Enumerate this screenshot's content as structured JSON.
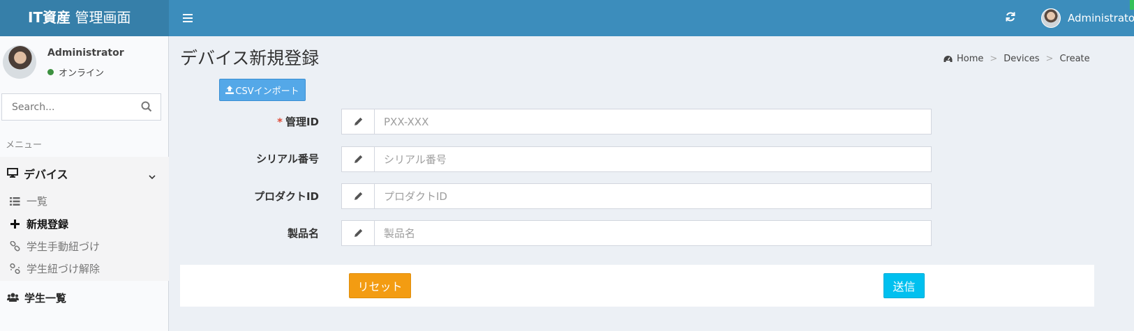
{
  "header": {
    "logo_bold": "IT資産",
    "logo_rest": " 管理画面",
    "user_name": "Administrator",
    "icons": {
      "menu": "hamburger-icon",
      "refresh": "refresh-icon"
    }
  },
  "sidebar": {
    "user": {
      "name": "Administrator",
      "status": "オンライン",
      "status_color": "#3d9140"
    },
    "search": {
      "placeholder": "Search...",
      "value": ""
    },
    "menu_header": "メニュー",
    "devices": {
      "label": "デバイス",
      "items": [
        {
          "label": "一覧",
          "icon": "list-icon",
          "active": false
        },
        {
          "label": "新規登録",
          "icon": "plus-icon",
          "active": true
        },
        {
          "label": "学生手動紐づけ",
          "icon": "link-icon",
          "active": false
        },
        {
          "label": "学生紐づけ解除",
          "icon": "unlink-icon",
          "active": false
        }
      ]
    },
    "students": {
      "label": "学生一覧",
      "icon": "users-icon"
    }
  },
  "content": {
    "title": "デバイス新規登録",
    "breadcrumb": [
      "Home",
      "Devices",
      "Create"
    ],
    "csv_button": "CSVインポート",
    "fields": [
      {
        "label": "管理ID",
        "required": true,
        "placeholder": "PXX-XXX",
        "value": ""
      },
      {
        "label": "シリアル番号",
        "required": false,
        "placeholder": "シリアル番号",
        "value": ""
      },
      {
        "label": "プロダクトID",
        "required": false,
        "placeholder": "プロダクトID",
        "value": ""
      },
      {
        "label": "製品名",
        "required": false,
        "placeholder": "製品名",
        "value": ""
      }
    ],
    "reset_button": "リセット",
    "submit_button": "送信"
  },
  "colors": {
    "header": "#3c8dbc",
    "logo_bg": "#367fa9",
    "reset": "#f39c12",
    "submit": "#00c0ef",
    "csv": "#54a8e8",
    "required": "#dd4b39"
  }
}
